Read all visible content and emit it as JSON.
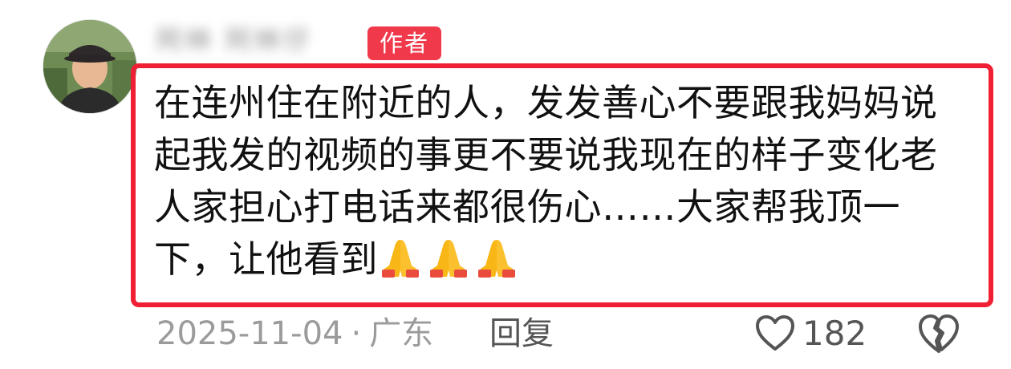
{
  "comment": {
    "username": "阿林 阿林仔",
    "badge": "作者",
    "text_lines": [
      "在连州住在附近的人，发发善心不要跟我妈妈说",
      "起我发的视频的事更不要说我现在的样子变化老",
      "人家担心打电话来都很伤心……大家帮我顶一",
      "下，让他看到"
    ],
    "emojis": [
      "folded-hands",
      "folded-hands",
      "folded-hands"
    ],
    "date": "2025-11-04",
    "separator": "·",
    "location": "广东",
    "reply_label": "回复",
    "like_count": "182"
  },
  "colors": {
    "badge": "#f0394b",
    "highlight_border": "#f01f33",
    "meta_text": "#9b9b9b",
    "icon": "#555555"
  }
}
